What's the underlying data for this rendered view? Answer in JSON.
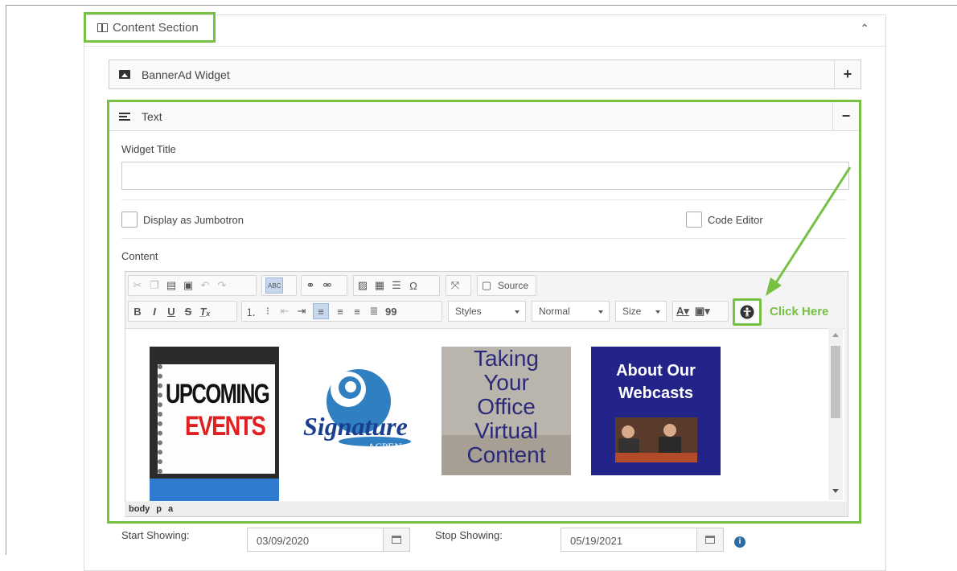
{
  "section": {
    "title": "Content Section"
  },
  "widgets": {
    "banner": {
      "title": "BannerAd Widget",
      "toggle": "+"
    },
    "text": {
      "title": "Text",
      "toggle": "−"
    }
  },
  "form": {
    "widget_title_label": "Widget Title",
    "widget_title_value": "",
    "jumbotron_label": "Display as Jumbotron",
    "code_editor_label": "Code Editor",
    "content_label": "Content"
  },
  "editor": {
    "source_label": "Source",
    "styles_label": "Styles",
    "format_label": "Normal",
    "size_label": "Size",
    "bold": "B",
    "italic": "I",
    "underline": "U",
    "strike": "S",
    "omega": "Ω",
    "quote": "99",
    "spell": "ABC",
    "path": [
      "body",
      "p",
      "a"
    ]
  },
  "annotation": {
    "click_here": "Click Here"
  },
  "tiles": {
    "events_line1": "UPCOMING",
    "events_line2": "EVENTS",
    "signature_text": "Signature",
    "acpen_text": "ACPEN",
    "office_text": [
      "Taking",
      "Your",
      "Office",
      "Virtual",
      "Content"
    ],
    "webcasts_text": [
      "About Our",
      "Webcasts"
    ]
  },
  "schedule": {
    "start_label": "Start Showing:",
    "start_value": "03/09/2020",
    "stop_label": "Stop Showing:",
    "stop_value": "05/19/2021"
  },
  "colors": {
    "accent": "#76c043",
    "info": "#2e6da4"
  }
}
